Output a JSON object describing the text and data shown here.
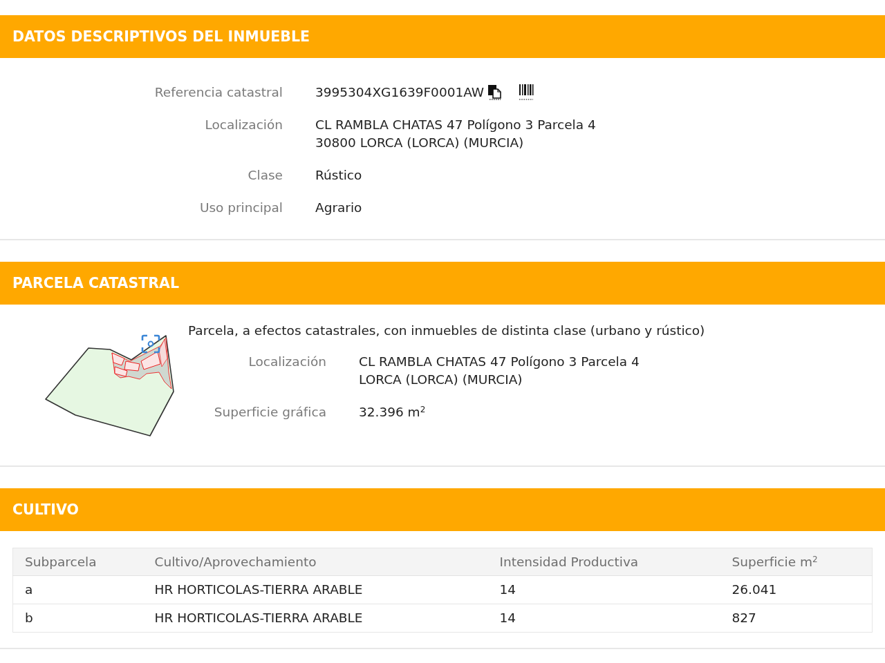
{
  "sections": [
    {
      "kind": "fields",
      "title": "DATOS DESCRIPTIVOS DEL INMUEBLE",
      "fields": [
        {
          "kind": "reference",
          "label": "Referencia catastral",
          "lines": [
            "3995304XG1639F0001AW"
          ]
        },
        {
          "kind": "text",
          "label": "Localización",
          "lines": [
            "CL RAMBLA CHATAS 47 Polígono 3 Parcela 4",
            "30800 LORCA (LORCA) (MURCIA)"
          ]
        },
        {
          "kind": "text",
          "label": "Clase",
          "lines": [
            "Rústico"
          ]
        },
        {
          "kind": "text",
          "label": "Uso principal",
          "lines": [
            "Agrario"
          ]
        }
      ]
    },
    {
      "kind": "parcel",
      "title": "PARCELA CATASTRAL",
      "note": "Parcela, a efectos catastrales, con inmuebles de distinta clase (urbano y rústico)",
      "fields": [
        {
          "kind": "text",
          "label": "Localización",
          "lines": [
            "CL RAMBLA CHATAS 47 Polígono 3 Parcela 4",
            "LORCA (LORCA) (MURCIA)"
          ]
        },
        {
          "kind": "text",
          "label": "Superficie gráfica",
          "lines": [
            "32.396 m$^{2}$"
          ]
        }
      ]
    },
    {
      "kind": "table",
      "title": "CULTIVO",
      "table": {
        "columns": [
          "Subparcela",
          "Cultivo/Aprovechamiento",
          "Intensidad Productiva",
          "Superficie m$^{2}$"
        ],
        "rows": [
          [
            "a",
            "HR HORTICOLAS-TIERRA ARABLE",
            "14",
            "26.041"
          ],
          [
            "b",
            "HR HORTICOLAS-TIERRA ARABLE",
            "14",
            "827"
          ]
        ]
      }
    }
  ]
}
